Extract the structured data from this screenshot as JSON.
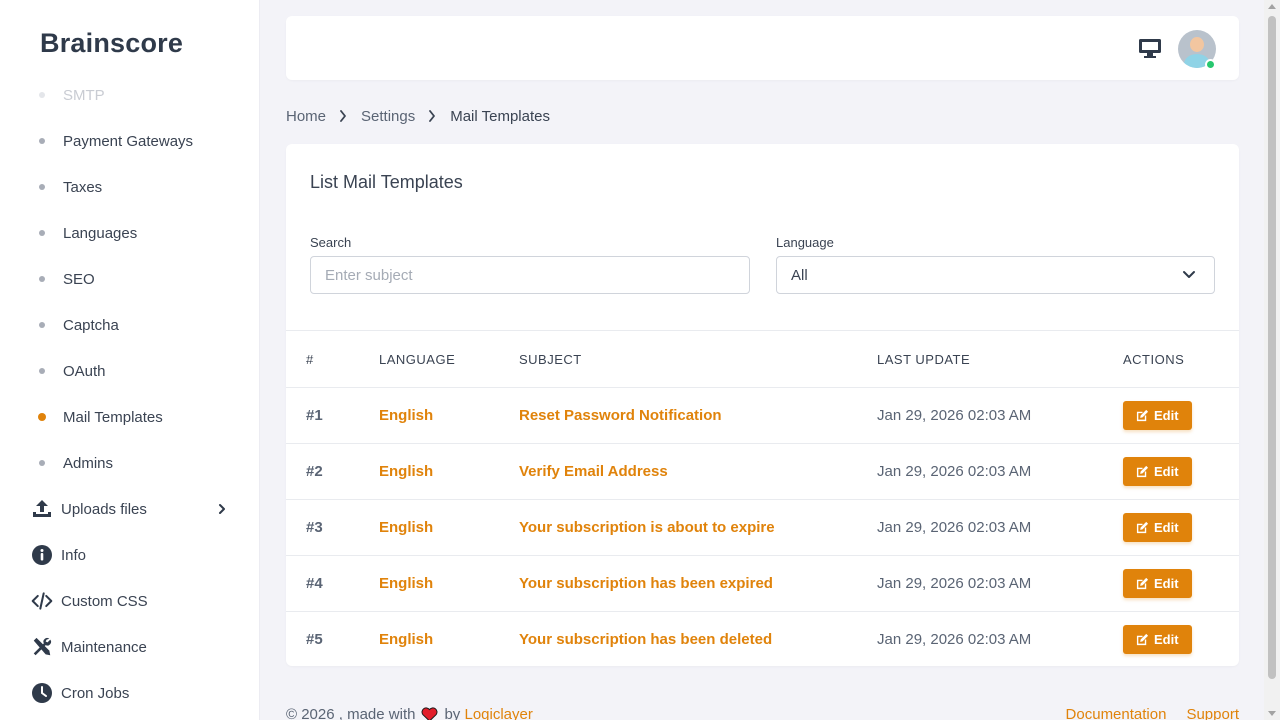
{
  "brand": "Brainscore",
  "sidebar": {
    "items": [
      {
        "label": "SMTP",
        "state": "faded"
      },
      {
        "label": "Payment Gateways"
      },
      {
        "label": "Taxes"
      },
      {
        "label": "Languages"
      },
      {
        "label": "SEO"
      },
      {
        "label": "Captcha"
      },
      {
        "label": "OAuth"
      },
      {
        "label": "Mail Templates",
        "state": "active"
      },
      {
        "label": "Admins"
      }
    ],
    "sections": [
      {
        "label": "Uploads files",
        "icon": "upload-icon"
      },
      {
        "label": "Info",
        "icon": "info-icon"
      },
      {
        "label": "Custom CSS",
        "icon": "code-icon"
      },
      {
        "label": "Maintenance",
        "icon": "tools-icon"
      },
      {
        "label": "Cron Jobs",
        "icon": "clock-icon"
      }
    ]
  },
  "breadcrumb": {
    "home": "Home",
    "settings": "Settings",
    "current": "Mail Templates"
  },
  "card": {
    "title": "List Mail Templates",
    "search_label": "Search",
    "search_placeholder": "Enter subject",
    "language_label": "Language",
    "language_value": "All"
  },
  "table": {
    "headers": [
      "#",
      "LANGUAGE",
      "SUBJECT",
      "LAST UPDATE",
      "ACTIONS"
    ],
    "edit_label": "Edit",
    "rows": [
      {
        "num": "#1",
        "language": "English",
        "subject": "Reset Password Notification",
        "updated": "Jan 29, 2026 02:03 AM"
      },
      {
        "num": "#2",
        "language": "English",
        "subject": "Verify Email Address",
        "updated": "Jan 29, 2026 02:03 AM"
      },
      {
        "num": "#3",
        "language": "English",
        "subject": "Your subscription is about to expire",
        "updated": "Jan 29, 2026 02:03 AM"
      },
      {
        "num": "#4",
        "language": "English",
        "subject": "Your subscription has been expired",
        "updated": "Jan 29, 2026 02:03 AM"
      },
      {
        "num": "#5",
        "language": "English",
        "subject": "Your subscription has been deleted",
        "updated": "Jan 29, 2026 02:03 AM"
      }
    ]
  },
  "footer": {
    "copyright": "© 2026 , made with",
    "by": "by",
    "author": "Logiclayer",
    "documentation": "Documentation",
    "support": "Support"
  },
  "colors": {
    "accent": "#e0830b",
    "online": "#28c76f",
    "heart": "#e11d2a"
  }
}
